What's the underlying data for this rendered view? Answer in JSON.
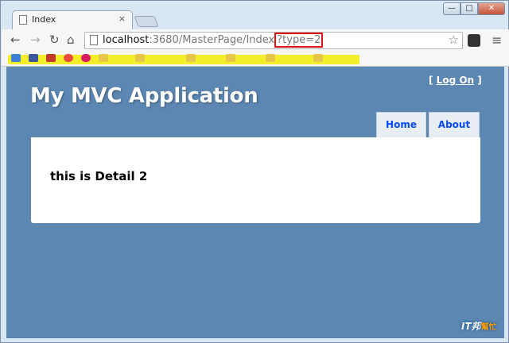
{
  "browser": {
    "tab_title": "Index",
    "tab_close": "×",
    "url_host": "localhost",
    "url_rest": ":3680/MasterPage/Index",
    "url_query": "?type=2"
  },
  "site": {
    "title": "My MVC Application",
    "login_open": "[",
    "login_label": "Log On",
    "login_close": "]",
    "menu": [
      {
        "label": "Home"
      },
      {
        "label": "About"
      }
    ],
    "content": "this is Detail 2"
  },
  "watermark": {
    "left": "IT邦",
    "right": "幫忙"
  }
}
